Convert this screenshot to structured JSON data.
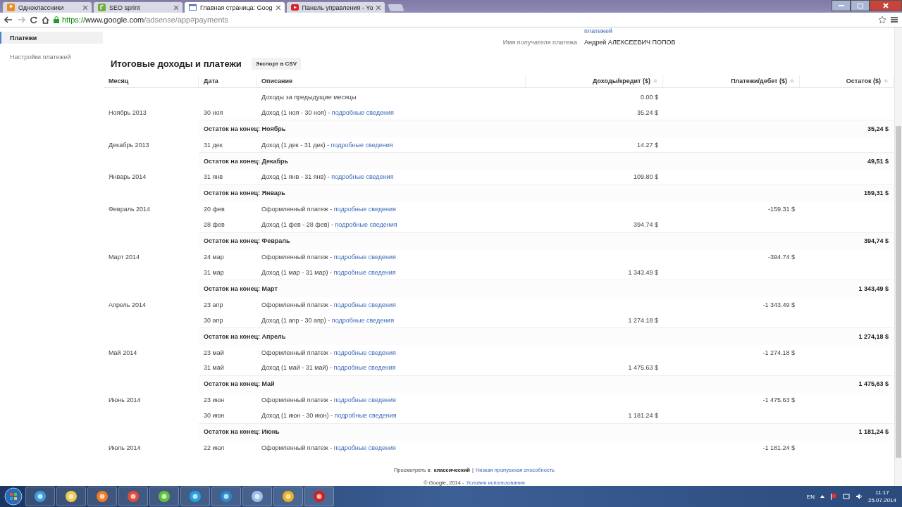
{
  "browser": {
    "tabs": [
      {
        "title": "Одноклассники",
        "selected": false
      },
      {
        "title": "SEO sprint",
        "selected": false
      },
      {
        "title": "Главная страница: Goog",
        "selected": true
      },
      {
        "title": "Панель управления - Yo",
        "selected": false
      }
    ],
    "url": {
      "scheme": "https://",
      "host": "www.google.com",
      "path": "/adsense/app#payments"
    }
  },
  "sidebar": {
    "items": [
      {
        "label": "Платежи",
        "selected": true
      },
      {
        "label": "Настройки платежей",
        "selected": false
      }
    ]
  },
  "payee": {
    "link_fragment": "платежей",
    "label": "Имя получателя платежа",
    "value": "Андрей АЛЕКСЕЕВИЧ ПОПОВ"
  },
  "summary": {
    "title": "Итоговые доходы и платежи",
    "export_button": "Экспорт в CSV",
    "columns": [
      "Месяц",
      "Дата",
      "Описание",
      "Доходы/кредит ($)",
      "Платежи/дебет ($)",
      "Остаток ($)"
    ],
    "rows": [
      {
        "kind": "entry",
        "description": "Доходы за предыдущие месяцы",
        "credit": "0.00 $"
      },
      {
        "kind": "entry",
        "month": "Ноябрь 2013",
        "date": "30 ноя",
        "description": "Доход (1 ноя - 30 ноя) -",
        "link": "подробные сведения",
        "credit": "35.24 $"
      },
      {
        "kind": "balance",
        "label": "Остаток на конец: Ноябрь",
        "balance": "35,24 $"
      },
      {
        "kind": "entry",
        "month": "Декабрь 2013",
        "date": "31 дек",
        "description": "Доход (1 дек - 31 дек) -",
        "link": "подробные сведения",
        "credit": "14.27 $"
      },
      {
        "kind": "balance",
        "label": "Остаток на конец: Декабрь",
        "balance": "49,51 $"
      },
      {
        "kind": "entry",
        "month": "Январь 2014",
        "date": "31 янв",
        "description": "Доход (1 янв - 31 янв) -",
        "link": "подробные сведения",
        "credit": "109.80 $"
      },
      {
        "kind": "balance",
        "label": "Остаток на конец: Январь",
        "balance": "159,31 $"
      },
      {
        "kind": "entry",
        "month": "Февраль 2014",
        "date": "20 фев",
        "description": "Оформленный платеж -",
        "link": "подробные сведения",
        "debit": "-159.31 $"
      },
      {
        "kind": "entry",
        "date": "28 фев",
        "description": "Доход (1 фев - 28 фев) -",
        "link": "подробные сведения",
        "credit": "394.74 $"
      },
      {
        "kind": "balance",
        "label": "Остаток на конец: Февраль",
        "balance": "394,74 $"
      },
      {
        "kind": "entry",
        "month": "Март 2014",
        "date": "24 мар",
        "description": "Оформленный платеж -",
        "link": "подробные сведения",
        "debit": "-394.74 $"
      },
      {
        "kind": "entry",
        "date": "31 мар",
        "description": "Доход (1 мар - 31 мар) -",
        "link": "подробные сведения",
        "credit": "1 343.49 $"
      },
      {
        "kind": "balance",
        "label": "Остаток на конец: Март",
        "balance": "1 343,49 $"
      },
      {
        "kind": "entry",
        "month": "Апрель 2014",
        "date": "23 апр",
        "description": "Оформленный платеж -",
        "link": "подробные сведения",
        "debit": "-1 343.49 $"
      },
      {
        "kind": "entry",
        "date": "30 апр",
        "description": "Доход (1 апр - 30 апр) -",
        "link": "подробные сведения",
        "credit": "1 274.18 $"
      },
      {
        "kind": "balance",
        "label": "Остаток на конец: Апрель",
        "balance": "1 274,18 $"
      },
      {
        "kind": "entry",
        "month": "Май 2014",
        "date": "23 май",
        "description": "Оформленный платеж -",
        "link": "подробные сведения",
        "debit": "-1 274.18 $"
      },
      {
        "kind": "entry",
        "date": "31 май",
        "description": "Доход (1 май - 31 май) -",
        "link": "подробные сведения",
        "credit": "1 475.63 $"
      },
      {
        "kind": "balance",
        "label": "Остаток на конец: Май",
        "balance": "1 475,63 $"
      },
      {
        "kind": "entry",
        "month": "Июнь 2014",
        "date": "23 июн",
        "description": "Оформленный платеж -",
        "link": "подробные сведения",
        "debit": "-1 475.63 $"
      },
      {
        "kind": "entry",
        "date": "30 июн",
        "description": "Доход (1 июн - 30 июн) -",
        "link": "подробные сведения",
        "credit": "1 181.24 $"
      },
      {
        "kind": "balance",
        "label": "Остаток на конец: Июнь",
        "balance": "1 181,24 $"
      },
      {
        "kind": "entry",
        "month": "Июль 2014",
        "date": "22 июл",
        "description": "Оформленный платеж -",
        "link": "подробные сведения",
        "debit": "-1 181.24 $"
      }
    ]
  },
  "footer": {
    "view_label": "Просмотреть в:",
    "view_current": "классический",
    "separator": "|",
    "low_bandwidth": "Низкая пропускная способность",
    "copyright": "© Google, 2014 -",
    "terms": "Условия использования"
  },
  "taskbar": {
    "language": "EN",
    "time": "11:17",
    "date": "25.07.2014"
  }
}
